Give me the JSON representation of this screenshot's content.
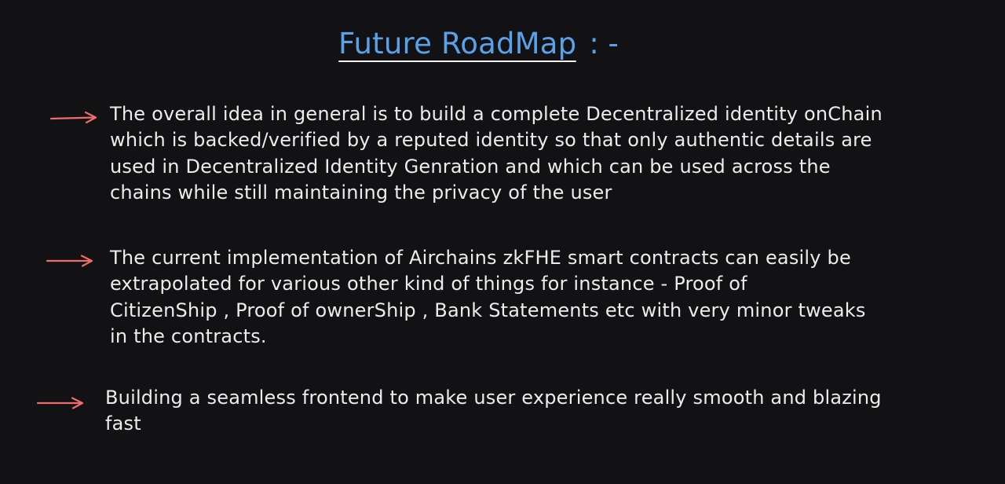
{
  "colors": {
    "background": "#121214",
    "title": "#5aa2e8",
    "arrow": "#f06b6b",
    "text": "#ececec"
  },
  "title": {
    "main": "Future RoadMap",
    "suffix": ": -"
  },
  "bullets": [
    {
      "icon": "arrow-right-icon",
      "lines": [
        "The overall idea in general is to build a complete Decentralized identity onChain",
        "which is backed/verified by a reputed identity so that only authentic details are",
        "used in Decentralized Identity Genration and which can be used across the",
        "chains while still maintaining the privacy of the user"
      ]
    },
    {
      "icon": "arrow-right-icon",
      "lines": [
        "The current implementation of Airchains zkFHE smart contracts can easily be",
        "extrapolated for various other kind of things for instance - Proof of",
        "CitizenShip , Proof of ownerShip , Bank Statements etc with very minor tweaks",
        "in the contracts."
      ]
    },
    {
      "icon": "arrow-right-icon",
      "lines": [
        "Building a seamless frontend to make user experience really smooth and blazing",
        "fast"
      ]
    }
  ]
}
